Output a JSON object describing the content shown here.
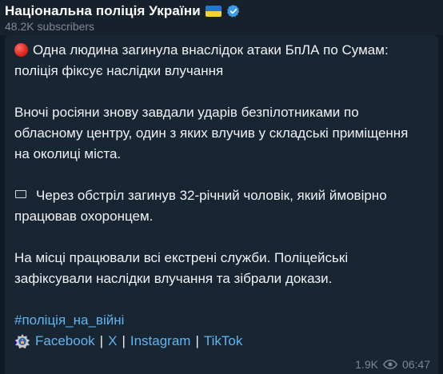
{
  "header": {
    "channel_name": "Національна поліція України",
    "flag_icon": "ukraine-flag-icon",
    "verified_icon": "verified-badge-icon",
    "subscribers": "48.2K subscribers"
  },
  "post": {
    "headline_icon": "red-circle-icon",
    "headline_line1": "Одна людина загинула внаслідок атаки БпЛА по Сумам:",
    "headline_line2": "поліція фіксує наслідки влучання",
    "p1_line1": "Вночі росіяни знову завдали ударів безпілотниками по",
    "p1_line2": "обласному центру, один з яких влучив у складські приміщення",
    "p1_line3": "на околиці міста.",
    "p2_icon": "black-square-icon",
    "p2_line1": "Через обстріл загинув 32-річний чоловік, який ймовірно",
    "p2_line2": "працював охоронцем.",
    "p3_line1": "На місці працювали всі екстрені служби. Поліцейські",
    "p3_line2": "зафіксували наслідки влучання та зібрали докази.",
    "hashtag": "#поліція_на_війні",
    "emblem_icon": "police-emblem-icon",
    "links": [
      "Facebook",
      "X",
      "Instagram",
      "TikTok"
    ],
    "separator": "|"
  },
  "footer": {
    "views": "1.9K",
    "views_icon": "eye-icon",
    "time": "06:47"
  },
  "colors": {
    "background": "#0f1a24",
    "header_bg": "#17212b",
    "bubble_bg": "#182533",
    "link": "#62b4ee",
    "text": "#f0f3f5",
    "muted": "#7b8994"
  }
}
